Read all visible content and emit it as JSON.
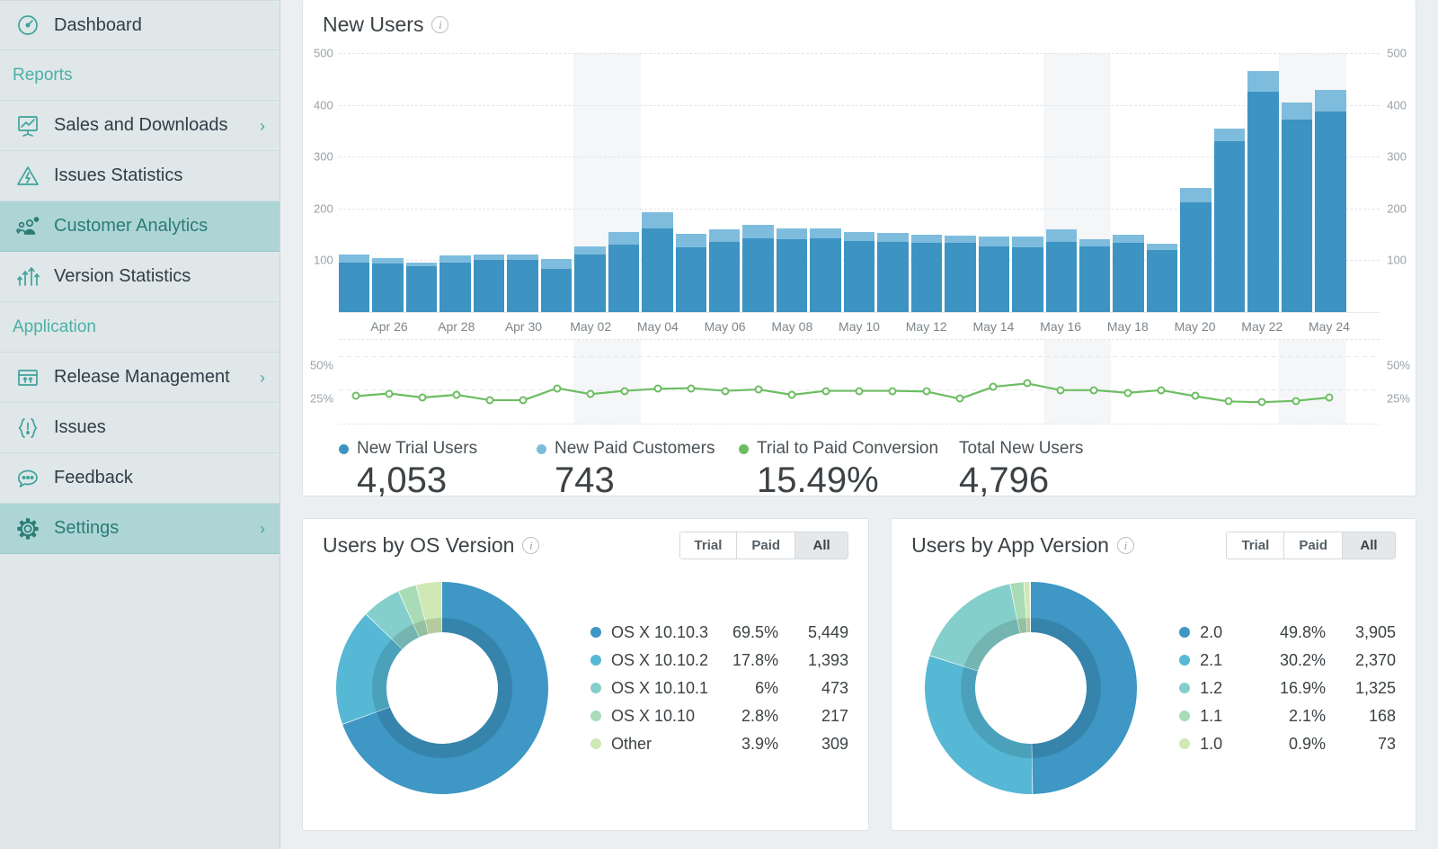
{
  "sidebar": {
    "items": [
      {
        "label": "Dashboard",
        "icon": "gauge-icon",
        "kind": "item",
        "chevron": false,
        "active": false
      },
      {
        "label": "Reports",
        "icon": "",
        "kind": "section",
        "chevron": false,
        "active": false
      },
      {
        "label": "Sales and Downloads",
        "icon": "presentation-chart-icon",
        "kind": "item",
        "chevron": true,
        "active": false
      },
      {
        "label": "Issues Statistics",
        "icon": "warning-triangle-icon",
        "kind": "item",
        "chevron": false,
        "active": false
      },
      {
        "label": "Customer Analytics",
        "icon": "people-network-icon",
        "kind": "item",
        "chevron": false,
        "active": true
      },
      {
        "label": "Version Statistics",
        "icon": "arrows-up-icon",
        "kind": "item",
        "chevron": false,
        "active": false
      },
      {
        "label": "Application",
        "icon": "",
        "kind": "section",
        "chevron": false,
        "active": false
      },
      {
        "label": "Release Management",
        "icon": "calendar-icon",
        "kind": "item",
        "chevron": true,
        "active": false
      },
      {
        "label": "Issues",
        "icon": "exclamation-icon",
        "kind": "item",
        "chevron": false,
        "active": false
      },
      {
        "label": "Feedback",
        "icon": "speech-bubble-icon",
        "kind": "item",
        "chevron": false,
        "active": false
      },
      {
        "label": "Settings",
        "icon": "gear-icon",
        "kind": "item",
        "chevron": true,
        "active": true
      }
    ],
    "chevron_glyph": "›"
  },
  "new_users_card": {
    "title": "New Users",
    "info_glyph": "i",
    "stats": [
      {
        "label": "New Trial Users",
        "value": "4,053",
        "color": "#3d93c2"
      },
      {
        "label": "New Paid Customers",
        "value": "743",
        "color": "#7ebcdd"
      },
      {
        "label": "Trial to Paid Conversion",
        "value": "15.49%",
        "color": "#6dbd63"
      },
      {
        "label": "Total New Users",
        "value": "4,796",
        "color": ""
      }
    ]
  },
  "os_card": {
    "title": "Users by OS Version",
    "info_glyph": "i",
    "toggles": [
      {
        "label": "Trial",
        "active": false
      },
      {
        "label": "Paid",
        "active": false
      },
      {
        "label": "All",
        "active": true
      }
    ]
  },
  "app_card": {
    "title": "Users by App Version",
    "info_glyph": "i",
    "toggles": [
      {
        "label": "Trial",
        "active": false
      },
      {
        "label": "Paid",
        "active": false
      },
      {
        "label": "All",
        "active": true
      }
    ]
  },
  "chart_data": [
    {
      "type": "bar",
      "title": "New Users",
      "stacked": true,
      "xlabel": "",
      "ylabel": "",
      "ylim": [
        0,
        500
      ],
      "yticks": [
        100,
        200,
        300,
        400,
        500
      ],
      "grid": true,
      "axis_both_sides": true,
      "categories": [
        "Apr 25",
        "Apr 26",
        "Apr 27",
        "Apr 28",
        "Apr 29",
        "Apr 30",
        "May 01",
        "May 02",
        "May 03",
        "May 04",
        "May 05",
        "May 06",
        "May 07",
        "May 08",
        "May 09",
        "May 10",
        "May 11",
        "May 12",
        "May 13",
        "May 14",
        "May 15",
        "May 16",
        "May 17",
        "May 18",
        "May 19",
        "May 20",
        "May 21",
        "May 22",
        "May 23",
        "May 24",
        "May 25"
      ],
      "tick_labels": [
        "Apr 26",
        "Apr 28",
        "Apr 30",
        "May 02",
        "May 04",
        "May 06",
        "May 08",
        "May 10",
        "May 12",
        "May 14",
        "May 16",
        "May 18",
        "May 20",
        "May 22",
        "May 24"
      ],
      "series": [
        {
          "name": "New Trial Users",
          "color": "#3d93c2",
          "values": [
            96,
            93,
            88,
            95,
            100,
            101,
            84,
            111,
            131,
            162,
            125,
            136,
            143,
            140,
            142,
            137,
            136,
            133,
            133,
            127,
            125,
            136,
            127,
            133,
            119,
            212,
            330,
            425,
            372,
            388,
            0
          ]
        },
        {
          "name": "New Paid Customers",
          "color": "#7ebcdd",
          "values": [
            16,
            11,
            8,
            14,
            11,
            10,
            19,
            15,
            24,
            30,
            26,
            24,
            25,
            21,
            19,
            17,
            17,
            16,
            14,
            19,
            20,
            24,
            13,
            16,
            13,
            28,
            24,
            40,
            33,
            40,
            0
          ]
        }
      ],
      "weekend_bands": [
        [
          "May 02",
          "May 03"
        ],
        [
          "May 16",
          "May 17"
        ],
        [
          "May 23",
          "May 24"
        ]
      ]
    },
    {
      "type": "line",
      "title": "Trial to Paid Conversion",
      "ylim": [
        0,
        62.5
      ],
      "yticks": [
        25,
        50
      ],
      "ytick_labels": [
        "25%",
        "50%"
      ],
      "grid": true,
      "series": [
        {
          "name": "Trial to Paid Conversion",
          "color": "#6dbd63",
          "values": [
            20.5,
            22.5,
            19.5,
            21.5,
            17.5,
            17.5,
            26.5,
            22.0,
            24.5,
            26.0,
            26.5,
            24.5,
            25.5,
            21.5,
            24.5,
            24.5,
            24.5,
            24.0,
            18.5,
            27.5,
            30.0,
            25.0,
            25.0,
            23.0,
            25.0,
            20.5,
            16.5,
            16.0,
            17.0,
            19.5
          ]
        }
      ]
    },
    {
      "type": "pie",
      "variant": "donut",
      "title": "Users by OS Version",
      "labels": [
        "OS X 10.10.3",
        "OS X 10.10.2",
        "OS X 10.10.1",
        "OS X 10.10",
        "Other"
      ],
      "percents": [
        "69.5%",
        "17.8%",
        "6%",
        "2.8%",
        "3.9%"
      ],
      "values": [
        "5,449",
        "1,393",
        "473",
        "217",
        "309"
      ],
      "numeric_percents": [
        69.5,
        17.8,
        6.0,
        2.8,
        3.9
      ],
      "colors": [
        "#3e97c4",
        "#56b8d4",
        "#84cfcb",
        "#a9dcb6",
        "#cfe8b6"
      ]
    },
    {
      "type": "pie",
      "variant": "donut",
      "title": "Users by App Version",
      "labels": [
        "2.0",
        "2.1",
        "1.2",
        "1.1",
        "1.0"
      ],
      "percents": [
        "49.8%",
        "30.2%",
        "16.9%",
        "2.1%",
        "0.9%"
      ],
      "values": [
        "3,905",
        "2,370",
        "1,325",
        "168",
        "73"
      ],
      "numeric_percents": [
        49.8,
        30.2,
        16.9,
        2.1,
        0.9
      ],
      "colors": [
        "#3e97c4",
        "#56b8d4",
        "#84cfcb",
        "#a9dcb6",
        "#cfe8b6"
      ]
    }
  ]
}
